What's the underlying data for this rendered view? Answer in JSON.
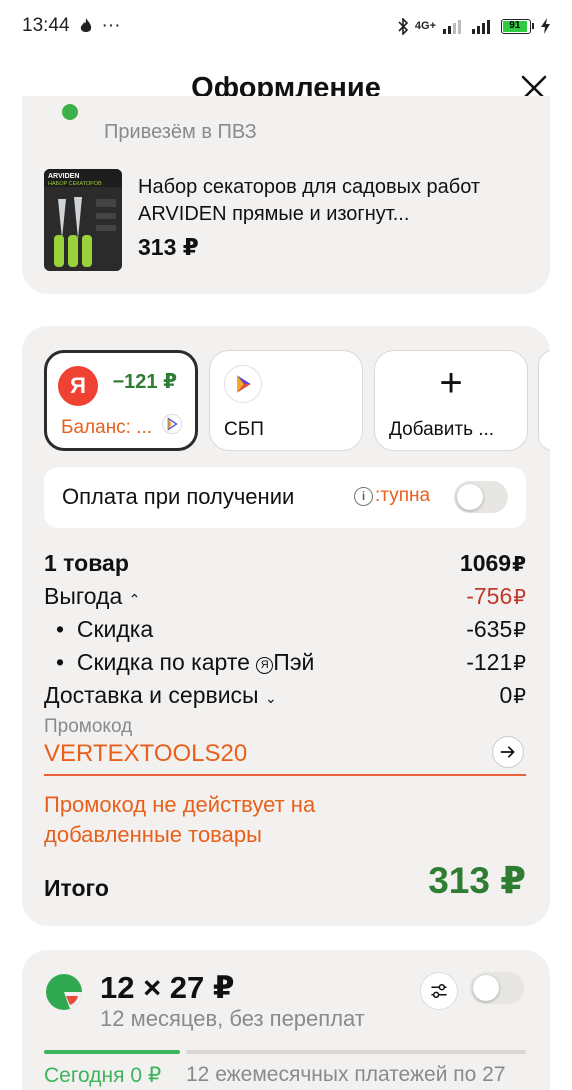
{
  "status_bar": {
    "time": "13:44",
    "more": "···",
    "network": "4G+",
    "battery": "91"
  },
  "header": {
    "title": "Оформление"
  },
  "delivery": {
    "method": "Привезём в ПВЗ"
  },
  "product": {
    "name": "Набор секаторов для садовых работ ARVIDEN прямые и изогнут...",
    "price": "313 ₽",
    "image_brand": "ARVIDEN",
    "image_caption": "НАБОР СЕКАТОРОВ"
  },
  "payment_methods": [
    {
      "label": "Баланс: ...",
      "amount": "−121 ₽",
      "selected": true
    },
    {
      "label": "СБП"
    },
    {
      "label": "Добавить ..."
    }
  ],
  "cash_on_delivery": {
    "label": "Оплата при получении",
    "note": ":тупна"
  },
  "summary": {
    "items_label": "1 товар",
    "items_value": "1069",
    "benefit_label": "Выгода",
    "benefit_value": "-756",
    "discount_label": "Скидка",
    "discount_value": "-635",
    "card_discount_label": "Скидка по карте",
    "card_discount_brand": "Пэй",
    "card_discount_value": "-121",
    "delivery_label": "Доставка и сервисы",
    "delivery_value": "0",
    "currency": "₽"
  },
  "promo": {
    "label": "Промокод",
    "code": "VERTEXTOOLS20",
    "error": "Промокод не действует на добавленные товары"
  },
  "total": {
    "label": "Итого",
    "value": "313 ₽"
  },
  "split": {
    "title": "12 × 27 ₽",
    "subtitle": "12 месяцев, без переплат",
    "today_label": "Сегодня 0 ₽",
    "rest_label": "12 ежемесячных платежей по 27"
  },
  "colors": {
    "accent_orange": "#e8601c",
    "green": "#2e7d32",
    "red": "#c0392b"
  }
}
